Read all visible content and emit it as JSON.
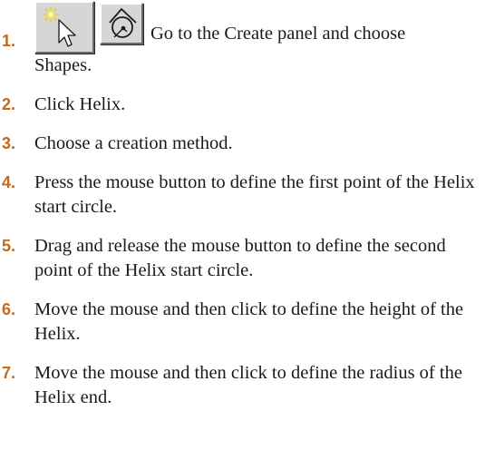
{
  "steps": [
    {
      "number": "1.",
      "text_line1": "Go to the Create panel and choose",
      "text_line2": "Shapes."
    },
    {
      "number": "2.",
      "text": "Click Helix."
    },
    {
      "number": "3.",
      "text": "Choose a creation method."
    },
    {
      "number": "4.",
      "text": "Press the mouse button to define the first point of the Helix start circle."
    },
    {
      "number": "5.",
      "text": "Drag and release the mouse button to define the second point of the Helix start circle."
    },
    {
      "number": "6.",
      "text": "Move the mouse and then click to define the height of the Helix."
    },
    {
      "number": "7.",
      "text": "Move the mouse and then click to define the radius of the Helix end."
    }
  ],
  "icons": {
    "create_panel": "create-panel-icon",
    "shapes": "shapes-icon"
  },
  "colors": {
    "step_number": "#c4691e",
    "text": "#1a1a1a",
    "button_face": "#d6d6d6"
  }
}
